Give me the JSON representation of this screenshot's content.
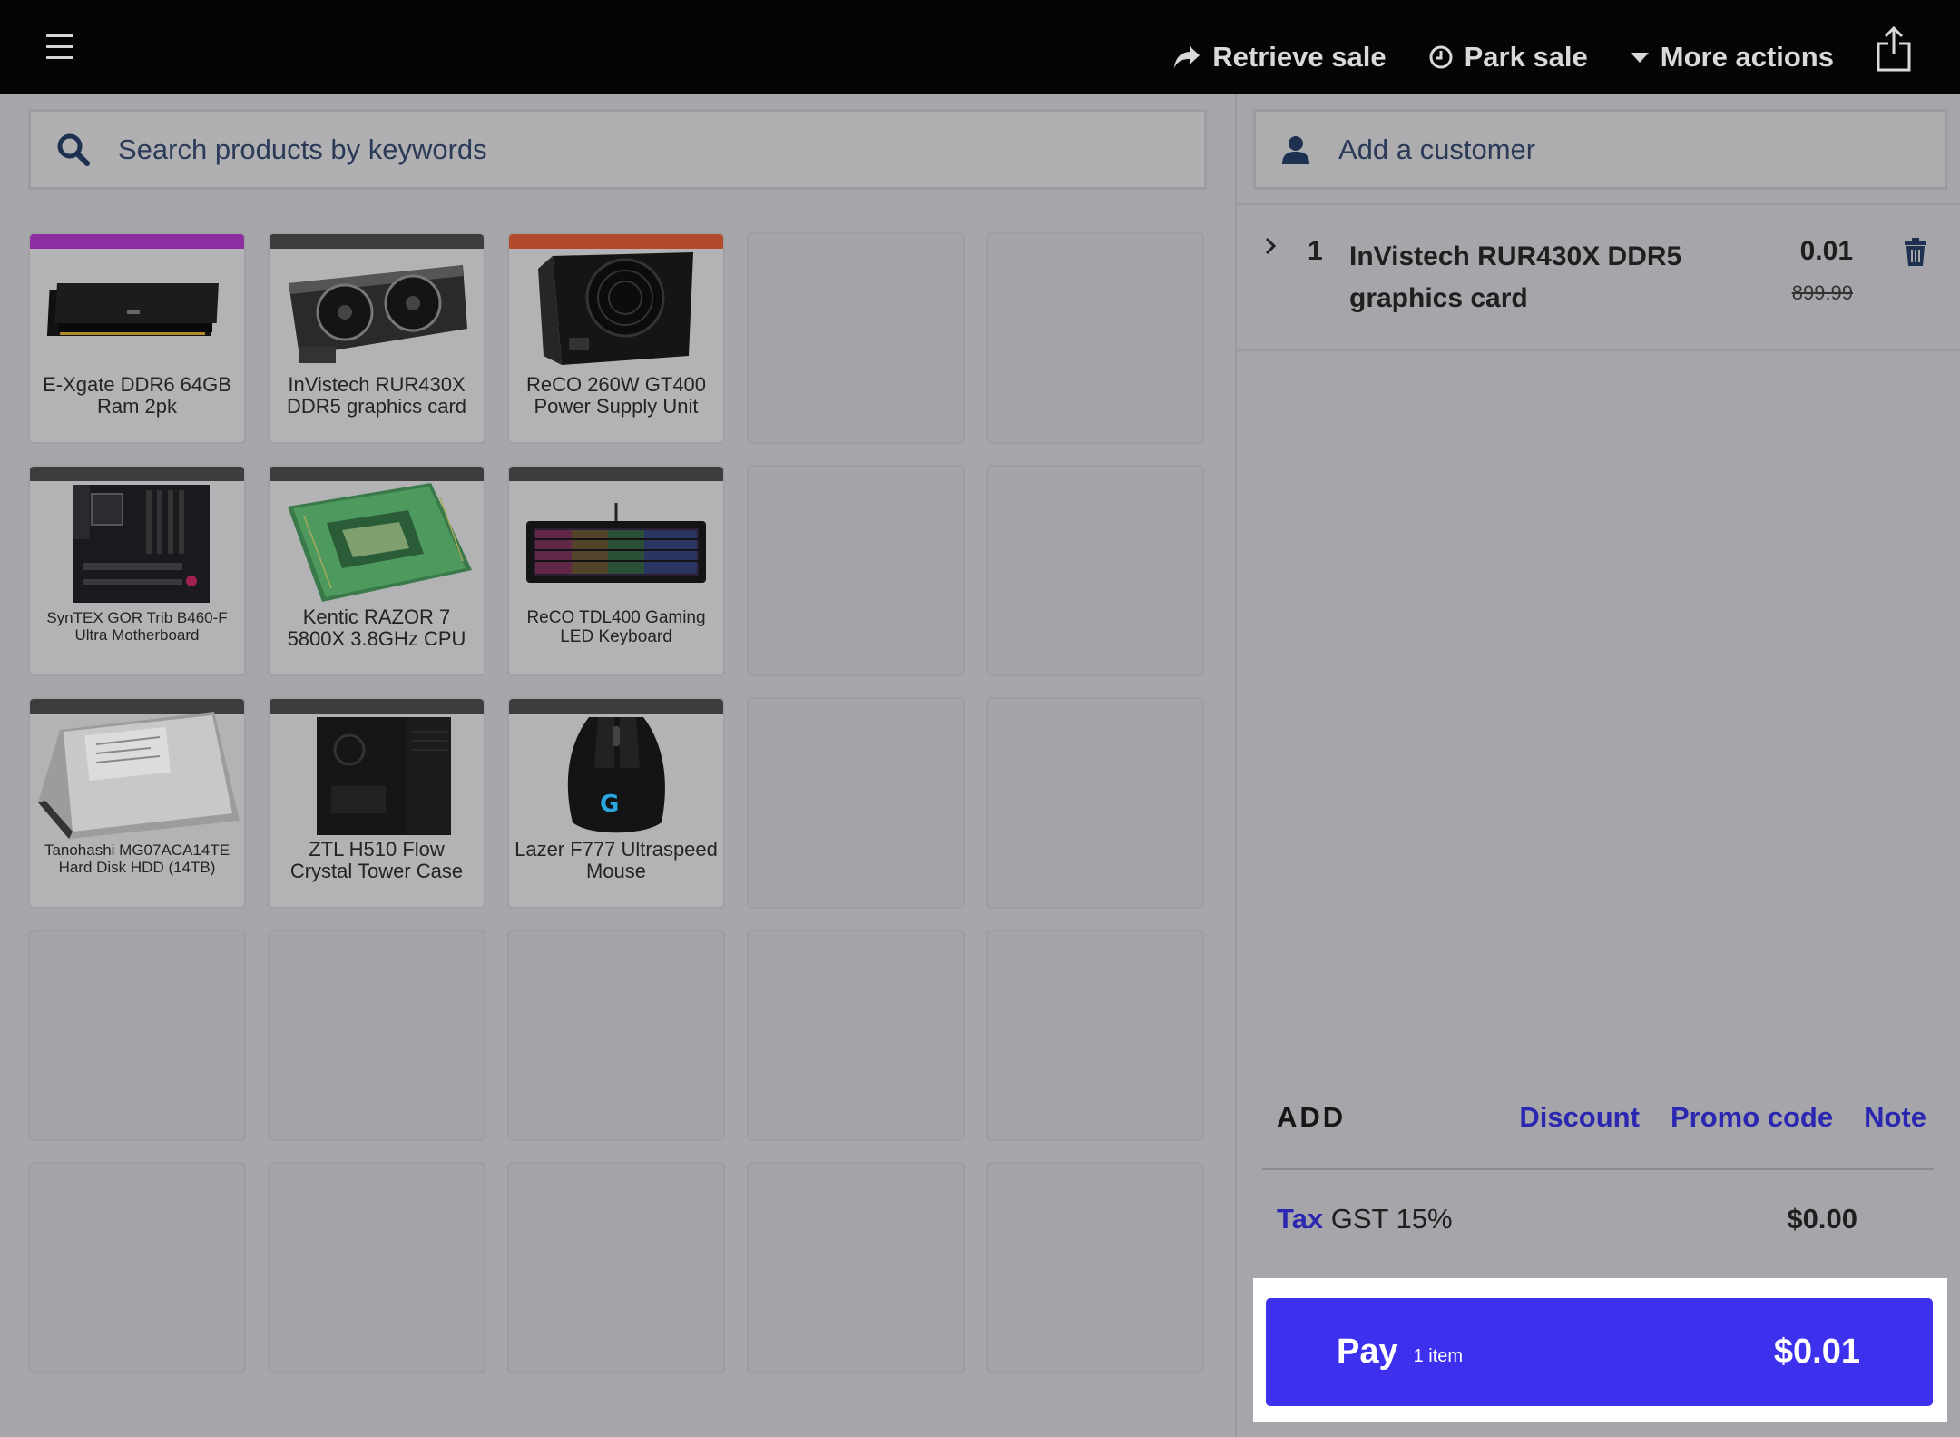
{
  "colors": {
    "topbar": "#050505",
    "accent_link": "#2c27b0",
    "pay_button": "#3d31ee",
    "overlay_gray": "#a6a6aa"
  },
  "topbar": {
    "menu_icon": "hamburger-icon",
    "actions": [
      {
        "label": "Retrieve sale",
        "icon": "share-arrow-icon"
      },
      {
        "label": "Park sale",
        "icon": "clock-icon"
      },
      {
        "label": "More actions",
        "icon": "caret-down-icon"
      }
    ],
    "share_icon": "share-upload-icon"
  },
  "search": {
    "placeholder": "Search products by keywords",
    "icon": "search-icon"
  },
  "products": [
    {
      "name": "E-Xgate DDR6 64GB Ram 2pk",
      "stripe": "#8e2da2",
      "icon": "ram-image"
    },
    {
      "name": "InVistech RUR430X DDR5 graphics card",
      "stripe": "#3d3d3f",
      "icon": "graphics-card-image"
    },
    {
      "name": "ReCO 260W GT400 Power Supply Unit",
      "stripe": "#b24a2c",
      "icon": "power-supply-image"
    },
    {
      "name": "SynTEX GOR Trib B460-F Ultra Motherboard",
      "stripe": "#3d3d3f",
      "icon": "motherboard-image"
    },
    {
      "name": "Kentic RAZOR 7 5800X 3.8GHz CPU",
      "stripe": "#3d3d3f",
      "icon": "cpu-image"
    },
    {
      "name": "ReCO TDL400 Gaming LED Keyboard",
      "stripe": "#3d3d3f",
      "icon": "keyboard-image"
    },
    {
      "name": "Tanohashi MG07ACA14TE Hard Disk HDD (14TB)",
      "stripe": "#3d3d3f",
      "icon": "hard-disk-image"
    },
    {
      "name": "ZTL H510 Flow Crystal Tower Case",
      "stripe": "#3d3d3f",
      "icon": "tower-case-image"
    },
    {
      "name": "Lazer F777 Ultraspeed Mouse",
      "stripe": "#3d3d3f",
      "icon": "mouse-image"
    }
  ],
  "customer": {
    "label": "Add a customer",
    "icon": "person-icon"
  },
  "cart": {
    "items": [
      {
        "qty": "1",
        "name": "InVistech RUR430X DDR5 graphics card",
        "price": "0.01",
        "original_price": "899.99"
      }
    ]
  },
  "add_section": {
    "label": "ADD",
    "links": [
      "Discount",
      "Promo code",
      "Note"
    ]
  },
  "tax": {
    "link": "Tax",
    "name": "GST 15%",
    "amount": "$0.00"
  },
  "pay": {
    "label": "Pay",
    "count": "1 item",
    "total": "$0.01"
  }
}
